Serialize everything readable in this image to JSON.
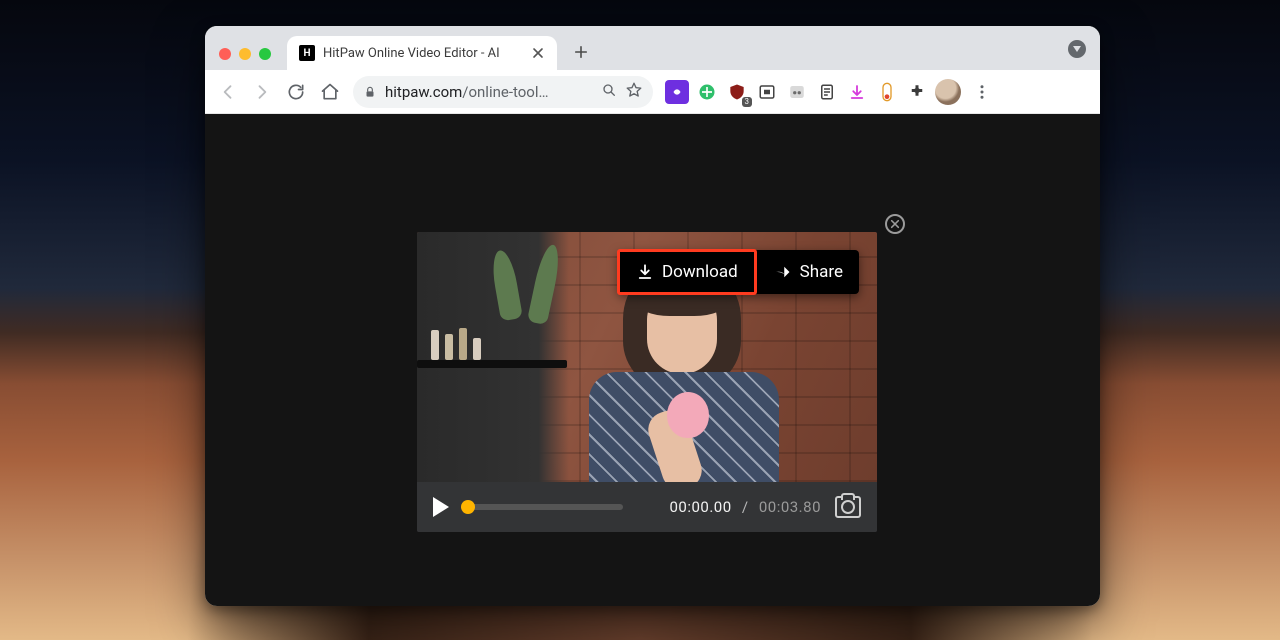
{
  "browser": {
    "tab_title": "HitPaw Online Video Editor - AI",
    "url_host": "hitpaw.com",
    "url_path": "/online-tool…",
    "extensions": {
      "ublock_badge": "3"
    }
  },
  "player": {
    "download_label": "Download",
    "share_label": "Share",
    "current_time": "00:00.00",
    "separator": "/",
    "duration": "00:03.80"
  }
}
